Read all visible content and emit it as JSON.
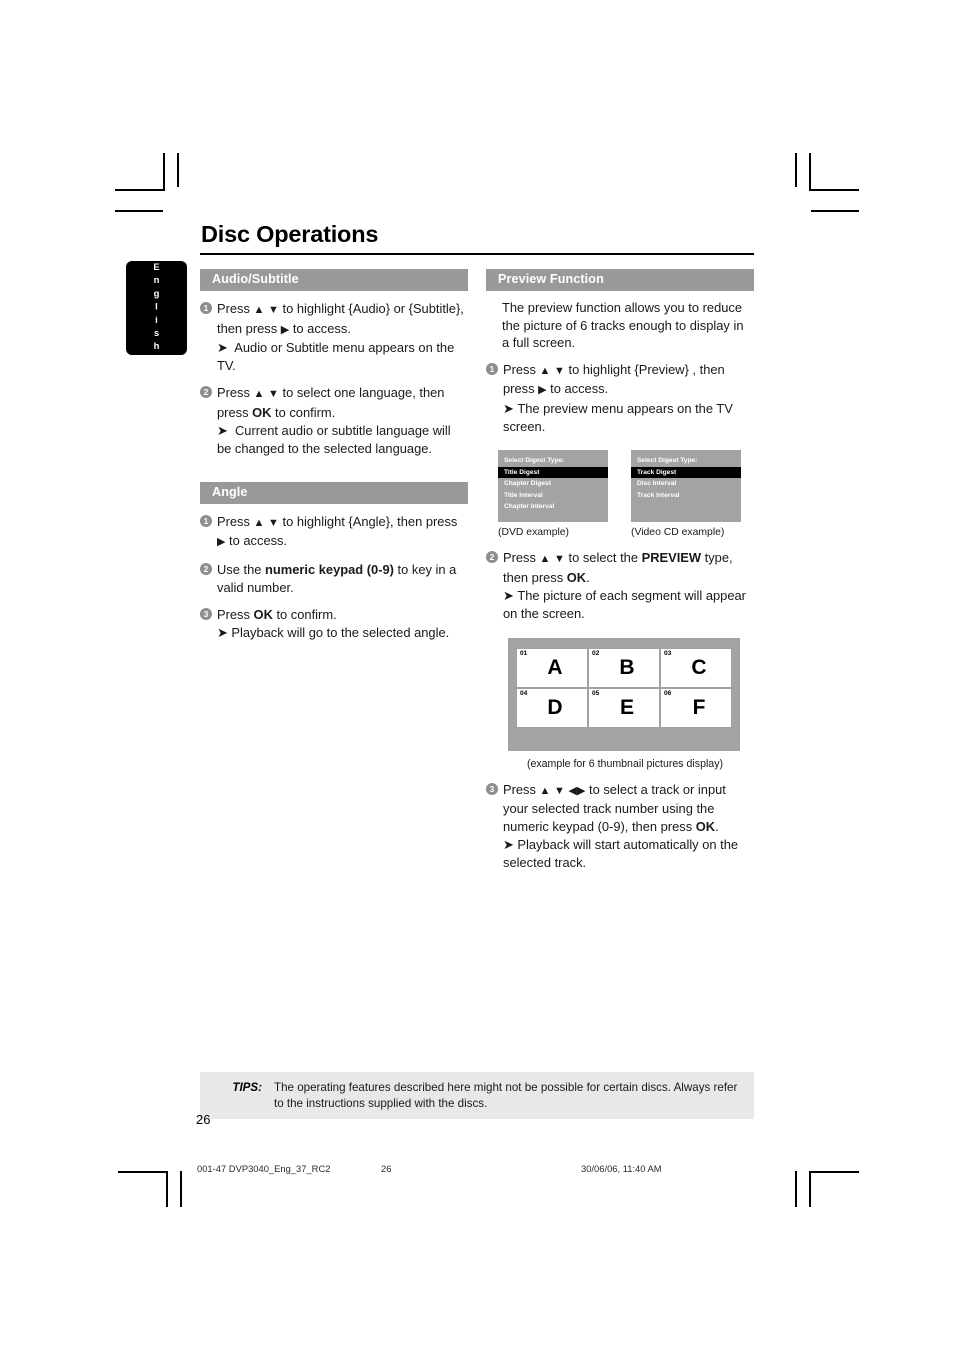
{
  "page": {
    "title": "Disc Operations",
    "language_tab": "English",
    "page_number": "26"
  },
  "left_column": {
    "sections": [
      {
        "header": "Audio/Subtitle",
        "steps": [
          {
            "number": "1",
            "lines": [
              "Press ▲ ▼ to highlight {Audio} or",
              "{Subtitle}, then press ▶ to access.",
              "➔  Audio or Subtitle menu appears on the",
              "TV."
            ]
          },
          {
            "number": "2",
            "lines": [
              "Press ▲ ▼ to select one language, then",
              "press OK to confirm.",
              "➔  Current audio or subtitle language will",
              "be changed to the selected language."
            ]
          }
        ]
      },
      {
        "header": "Angle",
        "steps": [
          {
            "number": "1",
            "lines": [
              "Press ▲ ▼ to highlight {Angle}, then press",
              "▶ to access."
            ]
          },
          {
            "number": "2",
            "lines": [
              "Use the numeric keypad (0-9) to key in",
              "a valid number."
            ]
          },
          {
            "number": "3",
            "lines": [
              "Press OK to confirm.",
              "➔ Playback will go to the selected angle."
            ]
          }
        ]
      }
    ]
  },
  "right_column": {
    "header": "Preview Function",
    "intro": "The preview function allows you to reduce the picture of 6 tracks enough to display in a full screen.",
    "step1": {
      "number": "1",
      "lines": [
        "Press ▲ ▼ to highlight {Preview} , then",
        "press ▶ to access.",
        "➔ The preview menu appears on the TV",
        "screen."
      ]
    },
    "digest_menus": [
      {
        "title": "Select Digest Type:",
        "items": [
          "Title Digest",
          "Chapter Digest",
          "Title Interval",
          "Chapter Interval"
        ],
        "selected": "Title Digest",
        "caption": "(DVD example)"
      },
      {
        "title": "Select Digest Type:",
        "items": [
          "Track Digest",
          "Disc Interval",
          "Track Interval"
        ],
        "selected": "Track Digest",
        "caption": "(Video CD example)"
      }
    ],
    "step2": {
      "number": "2",
      "lines": [
        "Press ▲ ▼ to select the PREVIEW type,",
        "then press OK.",
        "➔ The picture of each segment will",
        "appear on the screen."
      ]
    },
    "thumbnails": {
      "cells": [
        {
          "index": "01",
          "letter": "A"
        },
        {
          "index": "02",
          "letter": "B"
        },
        {
          "index": "03",
          "letter": "C"
        },
        {
          "index": "04",
          "letter": "D"
        },
        {
          "index": "05",
          "letter": "E"
        },
        {
          "index": "06",
          "letter": "F"
        }
      ],
      "caption": "(example for 6 thumbnail pictures display)"
    },
    "step3": {
      "number": "3",
      "lines": [
        "Press ▲ ▼ ◀ ▶ to select a track or input",
        "your selected track number using the",
        "numeric keypad (0-9), then press OK.",
        "➔ Playback will start automatically on the",
        "selected track."
      ]
    }
  },
  "tips": {
    "label": "TIPS:",
    "text": "The operating features described here might not be possible for certain discs.  Always refer to the instructions supplied with the discs."
  },
  "print_footer": {
    "file": "001-47 DVP3040_Eng_37_RC2",
    "page": "26",
    "date": "30/06/06, 11:40 AM"
  },
  "colors": {
    "section_bar": "#999999",
    "digest_bg": "#a3a3a3",
    "tips_bg": "#e8e8e8",
    "bullet": "#8e8e8e"
  }
}
